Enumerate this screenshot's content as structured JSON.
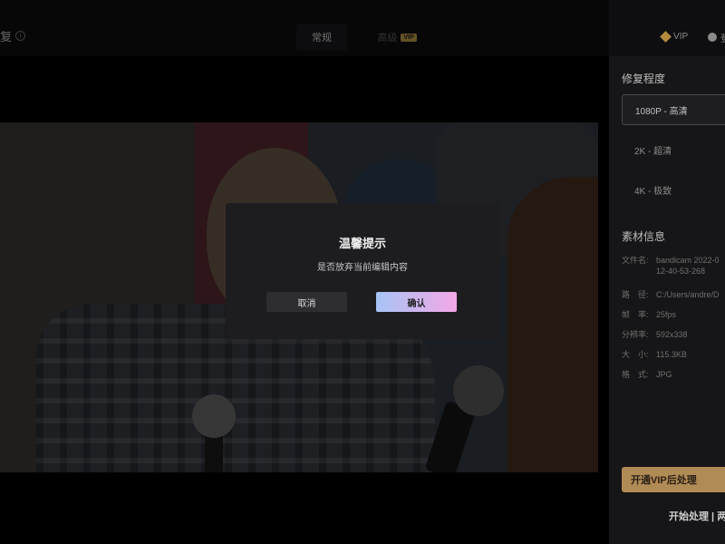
{
  "header": {
    "title": "复",
    "tabs": [
      {
        "label": "常规",
        "active": true
      },
      {
        "label": "高级",
        "badge": "VIP",
        "active": false
      }
    ],
    "vip_link": "VIP",
    "right_text": "登"
  },
  "panel": {
    "repair_heading": "修复程度",
    "options": [
      {
        "label": "1080P - 高清",
        "selected": true
      },
      {
        "label": "2K - 超清",
        "selected": false
      },
      {
        "label": "4K - 极致",
        "selected": false
      }
    ],
    "material_heading": "素材信息",
    "info": [
      {
        "label": "文件名:",
        "value": "bandicam 2022-0",
        "value2": "12-40-53-268"
      },
      {
        "label": "路　径:",
        "value": "C:/Users/andre/D"
      },
      {
        "label": "帧　率:",
        "value": "25fps"
      },
      {
        "label": "分辨率:",
        "value": "592x338"
      },
      {
        "label": "大　小:",
        "value": "115.3KB"
      },
      {
        "label": "格　式:",
        "value": "JPG"
      }
    ],
    "vip_button": "开通VIP后处理",
    "start_text": "开始处理 | 两"
  },
  "dialog": {
    "title": "温馨提示",
    "message": "是否放弃当前编辑内容",
    "cancel": "取消",
    "confirm": "确认"
  },
  "colors": {
    "accent_gold": "#b18b55",
    "confirm_gradient_start": "#a7c4f5",
    "confirm_gradient_end": "#f3a8e6",
    "background": "#111113"
  }
}
